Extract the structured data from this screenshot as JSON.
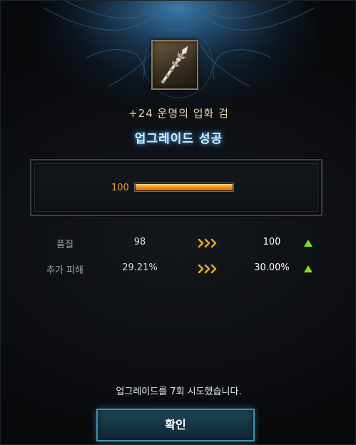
{
  "item": {
    "icon": "spear-weapon-icon",
    "name": "+24 운명의 업화 검"
  },
  "result": {
    "title": "업그레이드 성공"
  },
  "gauge": {
    "value_label": "100",
    "fill_fraction": 1.0,
    "fill_color": "#f59a20"
  },
  "stats": [
    {
      "label": "품질",
      "before": "98",
      "after": "100"
    },
    {
      "label": "추가 피해",
      "before": "29.21%",
      "after": "30.00%"
    }
  ],
  "footer": {
    "attempt_text": "업그레이드를 7회 시도했습니다.",
    "confirm_label": "확인"
  },
  "colors": {
    "accent_blue": "#3f8fb5",
    "arrow_gold": "#f3a621",
    "increase_green": "#7ee21c"
  }
}
